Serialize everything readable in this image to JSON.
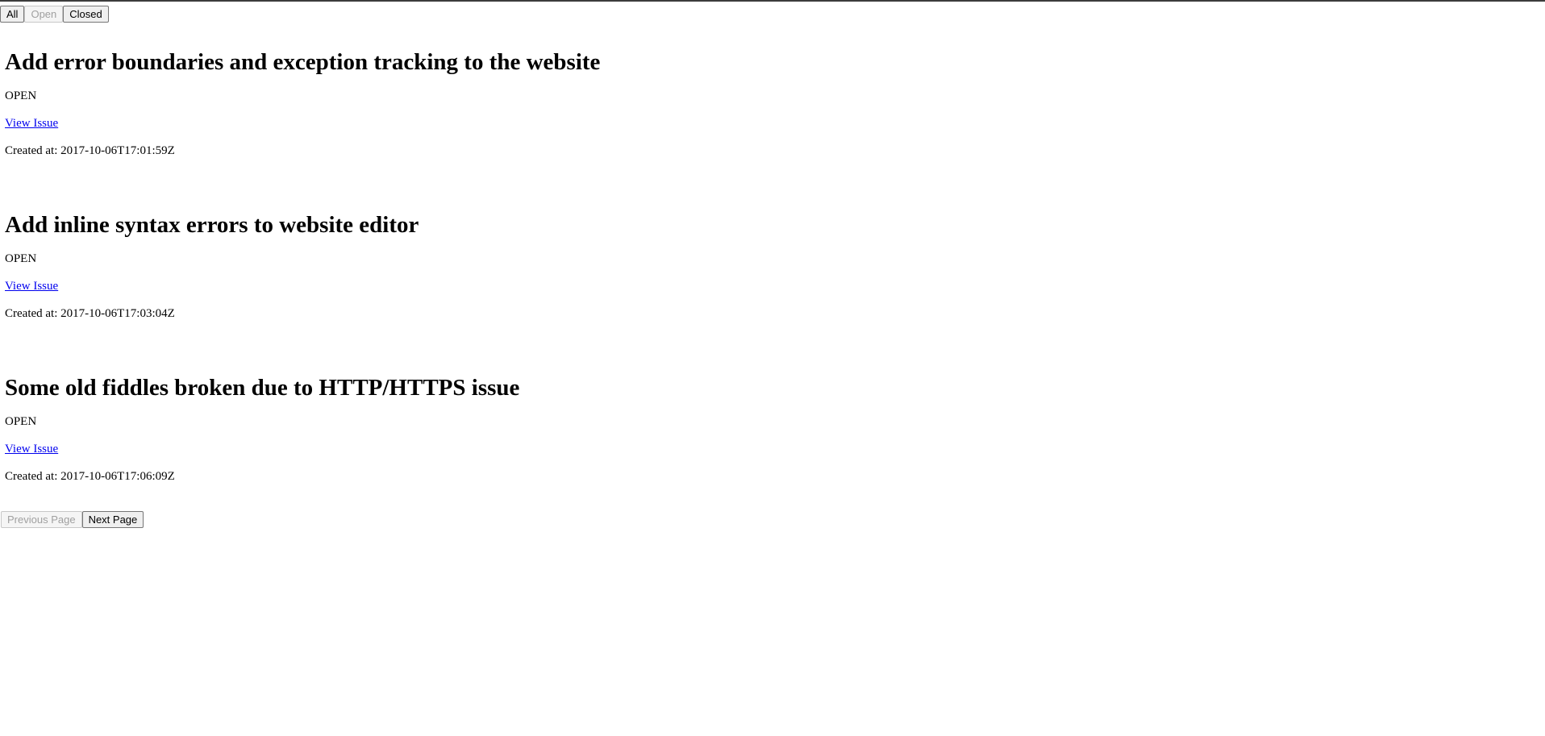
{
  "filters": {
    "all_label": "All",
    "open_label": "Open",
    "closed_label": "Closed"
  },
  "issues": [
    {
      "title": "Add error boundaries and exception tracking to the website",
      "state": "OPEN",
      "link_label": "View Issue",
      "created_at": "Created at: 2017-10-06T17:01:59Z"
    },
    {
      "title": "Add inline syntax errors to website editor",
      "state": "OPEN",
      "link_label": "View Issue",
      "created_at": "Created at: 2017-10-06T17:03:04Z"
    },
    {
      "title": "Some old fiddles broken due to HTTP/HTTPS issue",
      "state": "OPEN",
      "link_label": "View Issue",
      "created_at": "Created at: 2017-10-06T17:06:09Z"
    }
  ],
  "pagination": {
    "previous_label": "Previous Page",
    "next_label": "Next Page"
  }
}
